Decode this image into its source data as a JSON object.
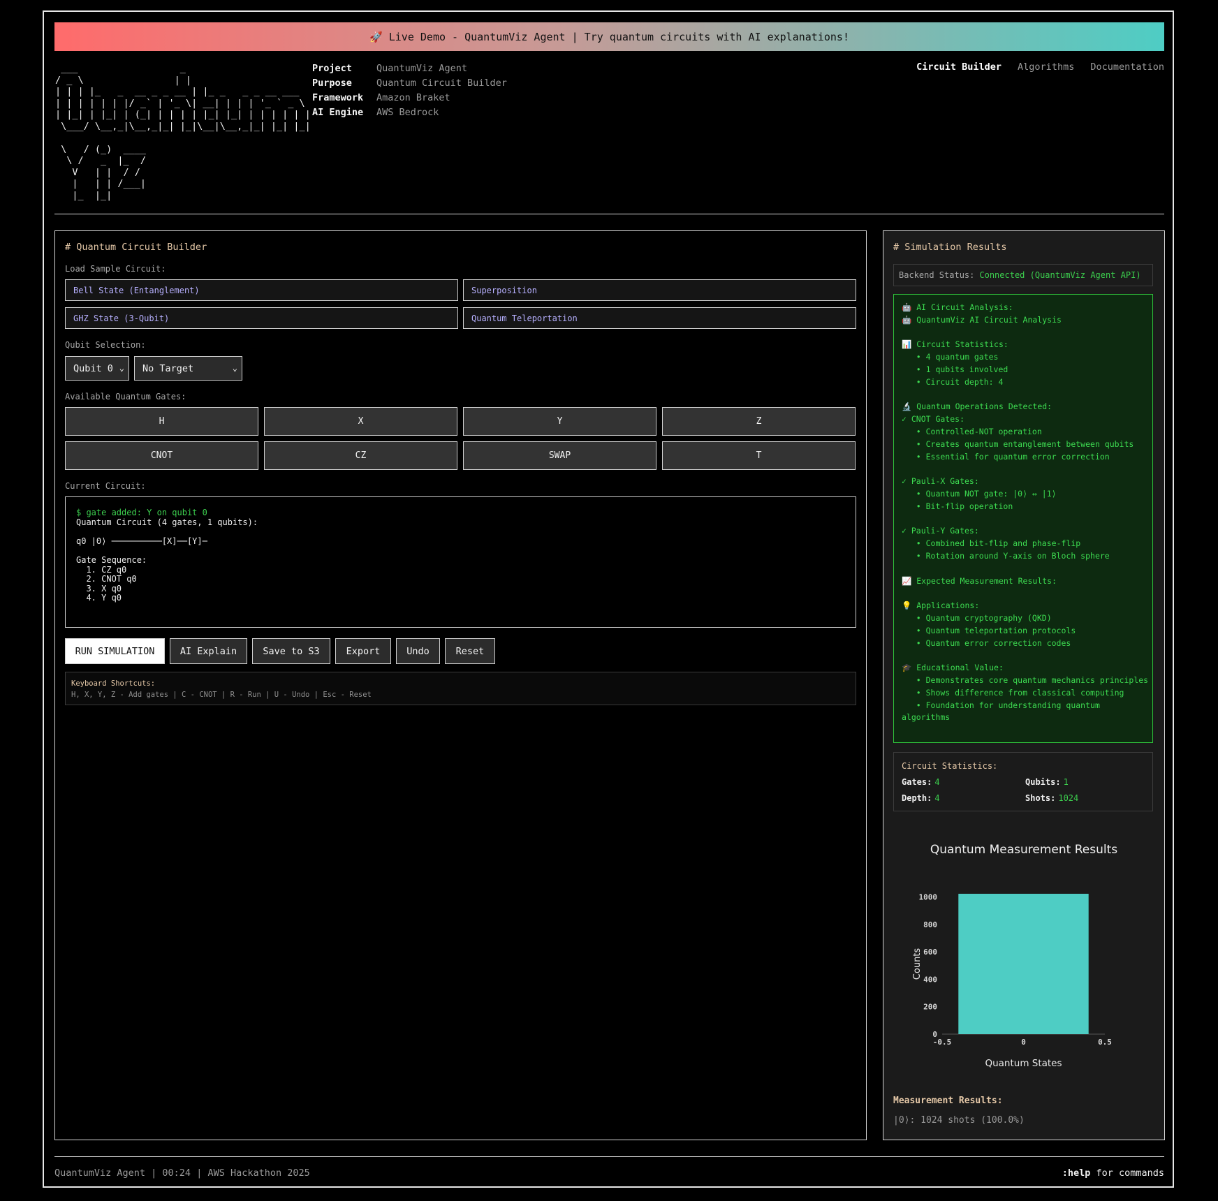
{
  "banner": {
    "text": "🚀 Live Demo - QuantumViz Agent | Try quantum circuits with AI explanations!"
  },
  "logo": {
    "ascii": " ___                  _\n/ _ \\                | |\n| | | |_   _  __ _ _ __ | |_ _   _ _ __ ___\n| | | | | | |/ _` | '_ \\| __| | | | '_ ` _ \\\n| |_| | |_| | (_| | | | | |_| |_| | | | | | |\n \\___/ \\__,_|\\__,_|_| |_|\\__|\\__,_|_| |_| |_|\n\n \\   / (_)  ____\n  \\ /   _  |_  /\n   V   | |  / /\n   |   | | /___|\n   |_  |_|"
  },
  "meta": [
    {
      "key": "Project",
      "value": "QuantumViz Agent"
    },
    {
      "key": "Purpose",
      "value": "Quantum Circuit Builder"
    },
    {
      "key": "Framework",
      "value": "Amazon Braket"
    },
    {
      "key": "AI Engine",
      "value": "AWS Bedrock"
    }
  ],
  "nav": {
    "builder": "Circuit Builder",
    "algorithms": "Algorithms",
    "docs": "Documentation"
  },
  "builder": {
    "title": "# Quantum Circuit Builder",
    "sample_label": "Load Sample Circuit:",
    "samples": [
      "Bell State (Entanglement)",
      "Superposition",
      "GHZ State (3-Qubit)",
      "Quantum Teleportation"
    ],
    "qubit_label": "Qubit Selection:",
    "qubit_select": "Qubit 0",
    "target_select": "No Target",
    "gates_label": "Available Quantum Gates:",
    "gates": [
      "H",
      "X",
      "Y",
      "Z",
      "CNOT",
      "CZ",
      "SWAP",
      "T"
    ],
    "circuit_label": "Current Circuit:",
    "circuit_log": "$ gate added: Y on qubit 0",
    "circuit_body": "Quantum Circuit (4 gates, 1 qubits):\n\nq0 |0⟩ ──────────[X]──[Y]─\n\nGate Sequence:\n  1. CZ q0\n  2. CNOT q0\n  3. X q0\n  4. Y q0",
    "actions": {
      "run": "RUN SIMULATION",
      "explain": "AI Explain",
      "save": "Save to S3",
      "export": "Export",
      "undo": "Undo",
      "reset": "Reset"
    },
    "shortcuts_title": "Keyboard Shortcuts:",
    "shortcuts_text": "H, X, Y, Z - Add gates | C - CNOT | R - Run | U - Undo | Esc - Reset"
  },
  "results": {
    "title": "# Simulation Results",
    "backend_label": "Backend Status:",
    "backend_value": "Connected (QuantumViz Agent API)",
    "analysis": "🤖 AI Circuit Analysis:\n🤖 QuantumViz AI Circuit Analysis\n\n📊 Circuit Statistics:\n   • 4 quantum gates\n   • 1 qubits involved\n   • Circuit depth: 4\n\n🔬 Quantum Operations Detected:\n✓ CNOT Gates:\n   • Controlled-NOT operation\n   • Creates quantum entanglement between qubits\n   • Essential for quantum error correction\n\n✓ Pauli-X Gates:\n   • Quantum NOT gate: |0⟩ ↔ |1⟩\n   • Bit-flip operation\n\n✓ Pauli-Y Gates:\n   • Combined bit-flip and phase-flip\n   • Rotation around Y-axis on Bloch sphere\n\n📈 Expected Measurement Results:\n\n💡 Applications:\n   • Quantum cryptography (QKD)\n   • Quantum teleportation protocols\n   • Quantum error correction codes\n\n🎓 Educational Value:\n   • Demonstrates core quantum mechanics principles\n   • Shows difference from classical computing\n   • Foundation for understanding quantum\nalgorithms",
    "stats_title": "Circuit Statistics:",
    "stats": {
      "gates_label": "Gates:",
      "gates": "4",
      "qubits_label": "Qubits:",
      "qubits": "1",
      "depth_label": "Depth:",
      "depth": "4",
      "shots_label": "Shots:",
      "shots": "1024"
    },
    "measure_title": "Measurement Results:",
    "measure_value": "|0⟩: 1024 shots (100.0%)"
  },
  "chart_data": {
    "type": "bar",
    "title": "Quantum Measurement Results",
    "xlabel": "Quantum States",
    "ylabel": "Counts",
    "x": [
      0
    ],
    "values": [
      1024
    ],
    "bar_width": 0.8,
    "xlim": [
      -0.5,
      0.5
    ],
    "ylim": [
      0,
      1024
    ],
    "xticks": [
      -0.5,
      0,
      0.5
    ],
    "yticks": [
      0,
      200,
      400,
      600,
      800,
      1000
    ],
    "color": "#4ecdc4",
    "grid": false
  },
  "footer": {
    "left": "QuantumViz Agent  |  00:24  |  AWS Hackathon 2025",
    "help_cmd": ":help",
    "help_text": " for commands"
  },
  "colors": {
    "accent_green": "#3ccf4e",
    "banner_start": "#ff6b6b",
    "banner_end": "#4ecdc4",
    "bar": "#4ecdc4"
  }
}
